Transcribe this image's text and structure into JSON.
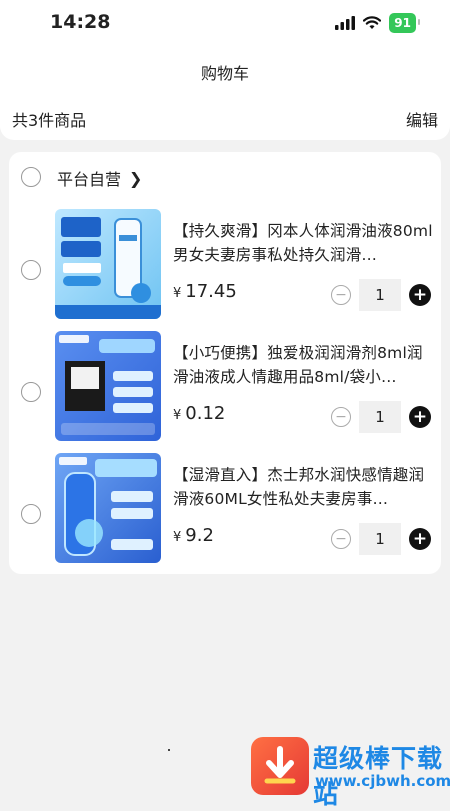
{
  "status_bar": {
    "time": "14:28",
    "battery": "91"
  },
  "header": {
    "title": "购物车",
    "item_count": "共3件商品",
    "edit_label": "编辑"
  },
  "shop": {
    "name": "平台自营"
  },
  "products": [
    {
      "title": "【持久爽滑】冈本人体润滑油液80ml男女夫妻房事私处持久润滑…",
      "currency": "¥",
      "price": "17.45",
      "quantity": "1"
    },
    {
      "title": "【小巧便携】独爱极润润滑剂8ml润滑油液成人情趣用品8ml/袋小…",
      "currency": "¥",
      "price": "0.12",
      "quantity": "1"
    },
    {
      "title": "【湿滑直入】杰士邦水润快感情趣润滑液60ML女性私处夫妻房事…",
      "currency": "¥",
      "price": "9.2",
      "quantity": "1"
    }
  ],
  "watermark": {
    "name": "超级棒下载站",
    "url": "www.cjbwh.com"
  },
  "icons": [
    "signal-icon",
    "wifi-icon",
    "chevron-right-icon",
    "minus-icon",
    "plus-icon"
  ],
  "colors": {
    "accent": "#111111",
    "background": "#f2f2f2",
    "battery": "#34c759"
  }
}
